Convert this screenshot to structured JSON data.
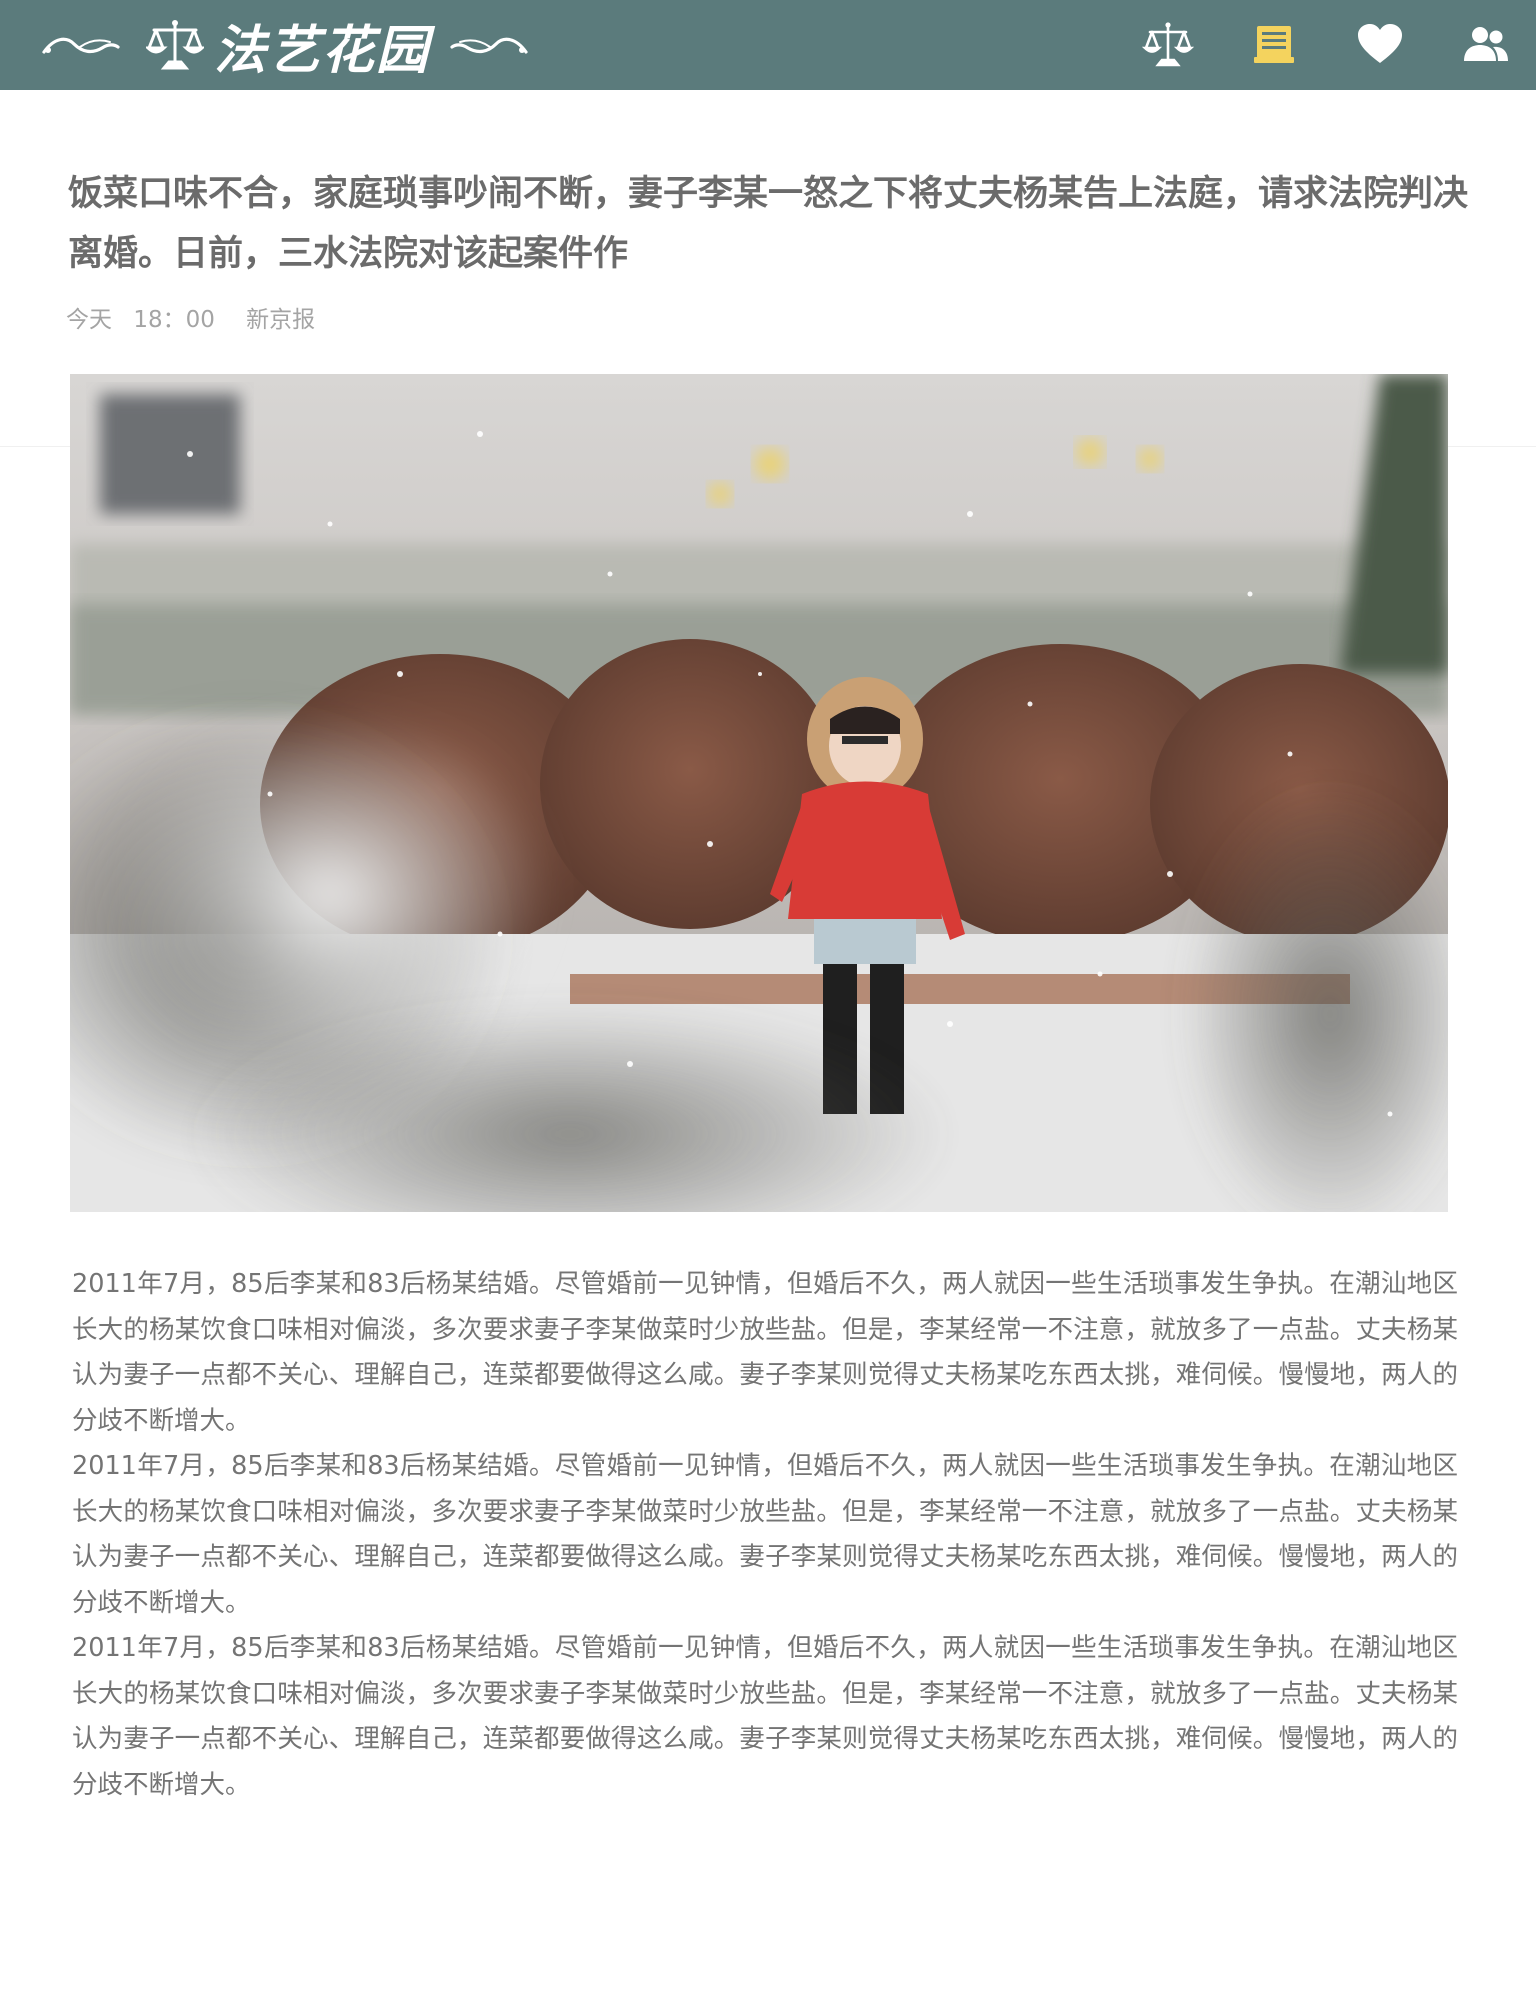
{
  "header": {
    "brand_title": "法艺花园",
    "icons": [
      {
        "name": "scale-icon",
        "color": "#ffffff"
      },
      {
        "name": "notebook-icon",
        "color": "#f4d35e"
      },
      {
        "name": "heart-icon",
        "color": "#ffffff"
      },
      {
        "name": "users-icon",
        "color": "#ffffff"
      }
    ],
    "background": "#5b7b7c"
  },
  "article": {
    "title": "饭菜口味不合，家庭琐事吵闹不断，妻子李某一怒之下将丈夫杨某告上法庭，请求法院判决离婚。日前，三水法院对该起案件作",
    "meta": {
      "day": "今天",
      "time": "18：00",
      "source": "新京报"
    },
    "hero_image_alt": "snow-scene-photo",
    "paragraphs": [
      "2011年7月，85后李某和83后杨某结婚。尽管婚前一见钟情，但婚后不久，两人就因一些生活琐事发生争执。在潮汕地区长大的杨某饮食口味相对偏淡，多次要求妻子李某做菜时少放些盐。但是，李某经常一不注意，就放多了一点盐。丈夫杨某认为妻子一点都不关心、理解自己，连菜都要做得这么咸。妻子李某则觉得丈夫杨某吃东西太挑，难伺候。慢慢地，两人的分歧不断增大。",
      "2011年7月，85后李某和83后杨某结婚。尽管婚前一见钟情，但婚后不久，两人就因一些生活琐事发生争执。在潮汕地区长大的杨某饮食口味相对偏淡，多次要求妻子李某做菜时少放些盐。但是，李某经常一不注意，就放多了一点盐。丈夫杨某认为妻子一点都不关心、理解自己，连菜都要做得这么咸。妻子李某则觉得丈夫杨某吃东西太挑，难伺候。慢慢地，两人的分歧不断增大。",
      "2011年7月，85后李某和83后杨某结婚。尽管婚前一见钟情，但婚后不久，两人就因一些生活琐事发生争执。在潮汕地区长大的杨某饮食口味相对偏淡，多次要求妻子李某做菜时少放些盐。但是，李某经常一不注意，就放多了一点盐。丈夫杨某认为妻子一点都不关心、理解自己，连菜都要做得这么咸。妻子李某则觉得丈夫杨某吃东西太挑，难伺候。慢慢地，两人的分歧不断增大。"
    ]
  }
}
